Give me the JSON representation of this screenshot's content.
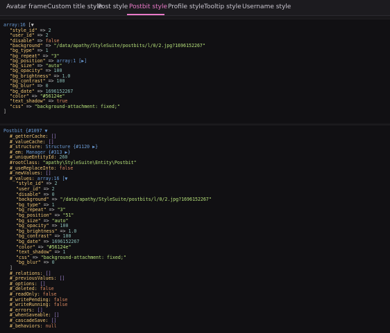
{
  "tabs": [
    {
      "label": "Avatar frame"
    },
    {
      "label": "Custom title style"
    },
    {
      "label": "Post style"
    },
    {
      "label": "Postbit style"
    },
    {
      "label": "Profile style"
    },
    {
      "label": "Tooltip style"
    },
    {
      "label": "Username style"
    }
  ],
  "active_tab": "Postbit style",
  "dump1": {
    "header": "array:16",
    "rows": [
      {
        "key": "\"style_id\"",
        "val": "2"
      },
      {
        "key": "\"user_id\"",
        "val": "2"
      },
      {
        "key": "\"disable\"",
        "val": "false"
      },
      {
        "key": "\"background\"",
        "val": "\"/data/apathy/StyleSuite/postbits/l/0/2.jpg?1696152267\""
      },
      {
        "key": "\"bg_type\"",
        "val": "1"
      },
      {
        "key": "\"bg_repeat\"",
        "val": "\"3\""
      },
      {
        "key": "\"bg_position\"",
        "val": "array:1 [▶]"
      },
      {
        "key": "\"bg_size\"",
        "val": "\"auto\""
      },
      {
        "key": "\"bg_opacity\"",
        "val": "100"
      },
      {
        "key": "\"bg_brightness\"",
        "val": "1.0"
      },
      {
        "key": "\"bg_contrast\"",
        "val": "100"
      },
      {
        "key": "\"bg_blur\"",
        "val": "0"
      },
      {
        "key": "\"bg_date\"",
        "val": "1696152267"
      },
      {
        "key": "\"color\"",
        "val": "\"#56124e\""
      },
      {
        "key": "\"text_shadow\"",
        "val": "true"
      },
      {
        "key": "\"css\"",
        "val": "\"background-attachment: fixed;\""
      }
    ]
  },
  "dump2": {
    "header": "Postbit {#1097 ▼",
    "props": [
      {
        "key": "#_getterCache:",
        "val": "[]"
      },
      {
        "key": "#_valueCache:",
        "val": "[]"
      },
      {
        "key": "#_structure:",
        "val": "Structure {#1120 ▶}"
      },
      {
        "key": "#_em:",
        "val": "Manager {#313 ▶}"
      },
      {
        "key": "#_uniqueEntityId:",
        "val": "260"
      },
      {
        "key": "#rootClass:",
        "val": "\"apathy\\StyleSuite\\Entity\\Postbit\""
      },
      {
        "key": "#_useReplaceInto:",
        "val": "false"
      },
      {
        "key": "#_newValues:",
        "val": "[]"
      },
      {
        "key": "#_values:",
        "val": "array:16 [▼"
      }
    ],
    "values": [
      {
        "key": "\"style_id\"",
        "val": "2"
      },
      {
        "key": "\"user_id\"",
        "val": "2"
      },
      {
        "key": "\"disable\"",
        "val": "0"
      },
      {
        "key": "\"background\"",
        "val": "\"/data/apathy/StyleSuite/postbits/l/0/2.jpg?1696152267\""
      },
      {
        "key": "\"bg_type\"",
        "val": "1"
      },
      {
        "key": "\"bg_repeat\"",
        "val": "\"3\""
      },
      {
        "key": "\"bg_position\"",
        "val": "\"51\""
      },
      {
        "key": "\"bg_size\"",
        "val": "\"auto\""
      },
      {
        "key": "\"bg_opacity\"",
        "val": "100"
      },
      {
        "key": "\"bg_brightness\"",
        "val": "1.0"
      },
      {
        "key": "\"bg_contrast\"",
        "val": "100"
      },
      {
        "key": "\"bg_date\"",
        "val": "1696152267"
      },
      {
        "key": "\"color\"",
        "val": "\"#56124e\""
      },
      {
        "key": "\"text_shadow\"",
        "val": "1"
      },
      {
        "key": "\"css\"",
        "val": "\"background-attachment: fixed;\""
      },
      {
        "key": "\"bg_blur\"",
        "val": "0"
      }
    ],
    "tail": [
      {
        "key": "#_relations:",
        "val": "[]"
      },
      {
        "key": "#_previousValues:",
        "val": "[]"
      },
      {
        "key": "#_options:",
        "val": "[]"
      },
      {
        "key": "#_deleted:",
        "val": "false"
      },
      {
        "key": "#_readOnly:",
        "val": "false"
      },
      {
        "key": "#_writePending:",
        "val": "false"
      },
      {
        "key": "#_writeRunning:",
        "val": "false"
      },
      {
        "key": "#_errors:",
        "val": "[]"
      },
      {
        "key": "#_whenSaveable:",
        "val": "[]"
      },
      {
        "key": "#_cascadeSave:",
        "val": "[]"
      },
      {
        "key": "#_behaviors:",
        "val": "null"
      }
    ]
  },
  "colors": {
    "accent": "#e879c7",
    "key": "#f0c674",
    "number": "#8abeb7",
    "string": "#b5e07a",
    "type": "#6b9cd6"
  }
}
